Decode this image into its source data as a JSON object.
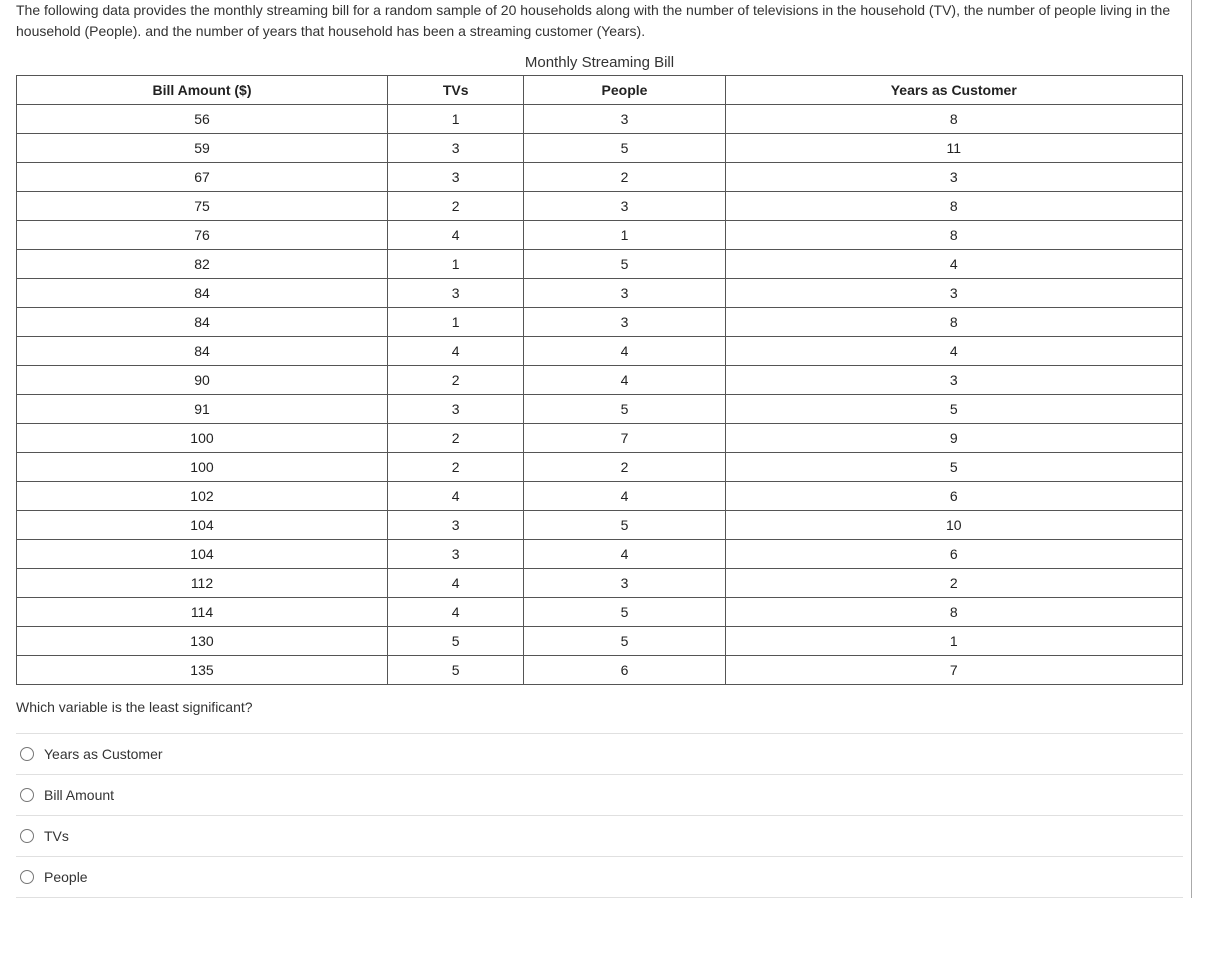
{
  "intro": "The following data provides the monthly streaming bill for a random sample of 20 households along with the number of televisions in the household (TV), the number of people living in the household (People). and the number of years that household has been a streaming customer (Years).",
  "table": {
    "caption": "Monthly Streaming Bill",
    "headers": [
      "Bill Amount ($)",
      "TVs",
      "People",
      "Years as Customer"
    ],
    "rows": [
      [
        "56",
        "1",
        "3",
        "8"
      ],
      [
        "59",
        "3",
        "5",
        "11"
      ],
      [
        "67",
        "3",
        "2",
        "3"
      ],
      [
        "75",
        "2",
        "3",
        "8"
      ],
      [
        "76",
        "4",
        "1",
        "8"
      ],
      [
        "82",
        "1",
        "5",
        "4"
      ],
      [
        "84",
        "3",
        "3",
        "3"
      ],
      [
        "84",
        "1",
        "3",
        "8"
      ],
      [
        "84",
        "4",
        "4",
        "4"
      ],
      [
        "90",
        "2",
        "4",
        "3"
      ],
      [
        "91",
        "3",
        "5",
        "5"
      ],
      [
        "100",
        "2",
        "7",
        "9"
      ],
      [
        "100",
        "2",
        "2",
        "5"
      ],
      [
        "102",
        "4",
        "4",
        "6"
      ],
      [
        "104",
        "3",
        "5",
        "10"
      ],
      [
        "104",
        "3",
        "4",
        "6"
      ],
      [
        "112",
        "4",
        "3",
        "2"
      ],
      [
        "114",
        "4",
        "5",
        "8"
      ],
      [
        "130",
        "5",
        "5",
        "1"
      ],
      [
        "135",
        "5",
        "6",
        "7"
      ]
    ]
  },
  "question": "Which variable is the least significant?",
  "options": [
    "Years as Customer",
    "Bill Amount",
    "TVs",
    "People"
  ]
}
